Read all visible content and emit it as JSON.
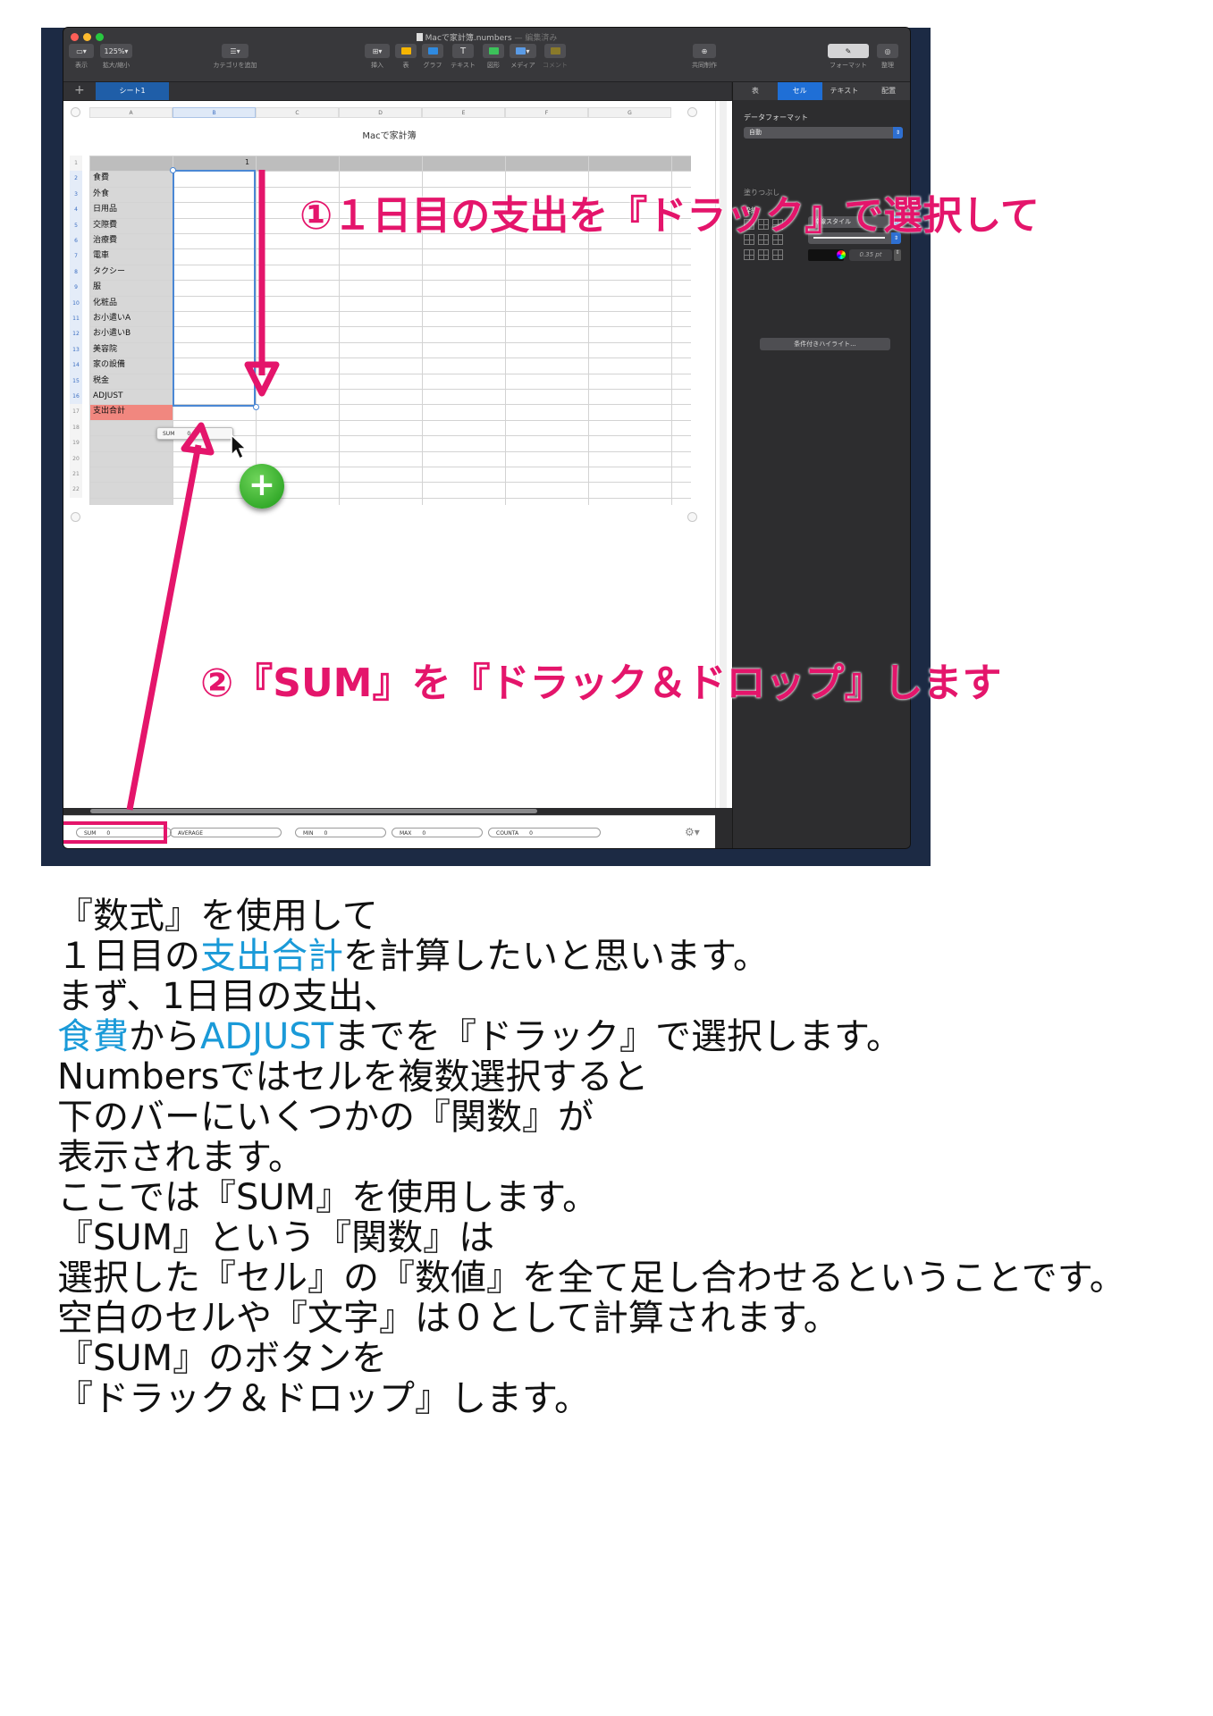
{
  "window": {
    "title": "Macで家計簿.numbers",
    "title_status": "— 編集済み"
  },
  "toolbar": {
    "view_label": "表示",
    "zoom_value": "125%",
    "zoom_label": "拡大/縮小",
    "category_label": "カテゴリを追加",
    "insert_label": "挿入",
    "table_label": "表",
    "chart_label": "グラフ",
    "text_label": "テキスト",
    "shape_label": "図形",
    "media_label": "メディア",
    "comment_label": "コメント",
    "collab_label": "共同制作",
    "format_label": "フォーマット",
    "organize_label": "整理"
  },
  "sheet_tab": "シート1",
  "spreadsheet": {
    "title": "Macで家計簿",
    "columns": [
      "A",
      "B",
      "C",
      "D",
      "E",
      "F",
      "G"
    ],
    "header_value": "1",
    "row_numbers": [
      "1",
      "2",
      "3",
      "4",
      "5",
      "6",
      "7",
      "8",
      "9",
      "10",
      "11",
      "12",
      "13",
      "14",
      "15",
      "16",
      "17",
      "18",
      "19",
      "20",
      "21",
      "22"
    ],
    "row_labels": [
      "食費",
      "外食",
      "日用品",
      "交際費",
      "治療費",
      "電車",
      "タクシー",
      "服",
      "化粧品",
      "お小遣いA",
      "お小遣いB",
      "美容院",
      "家の設備",
      "税金",
      "ADJUST",
      "支出合計"
    ],
    "sum_chip": {
      "label": "SUM",
      "value": "0"
    }
  },
  "formula_bar": [
    {
      "label": "SUM",
      "value": "0"
    },
    {
      "label": "AVERAGE",
      "value": ""
    },
    {
      "label": "MIN",
      "value": "0"
    },
    {
      "label": "MAX",
      "value": "0"
    },
    {
      "label": "COUNTA",
      "value": "0"
    }
  ],
  "inspector": {
    "tabs": [
      "表",
      "セル",
      "テキスト",
      "配置"
    ],
    "active_tab": "セル",
    "data_format_heading": "データフォーマット",
    "data_format_value": "自動",
    "fill_heading": "塗りつぶし",
    "border_heading": "枠線",
    "border_style_value": "枠線スタイル",
    "border_width": "0.35 pt",
    "conditional_button": "条件付きハイライト..."
  },
  "annotations": {
    "step1": "①１日目の支出を『ドラック』で選択して",
    "step2": "②『SUM』を『ドラック＆ドロップ』します",
    "color": "#e4156b"
  },
  "explanation": {
    "line1": "『数式』を使用して",
    "line2_pre": "１日目の",
    "line2_blue": "支出合計",
    "line2_post": "を計算したいと思います。",
    "line3": "まず、1日目の支出、",
    "line4_blue1": "食費",
    "line4_mid": "から",
    "line4_blue2": "ADJUST",
    "line4_post": "までを『ドラック』で選択します。",
    "line5": "Numbersではセルを複数選択すると",
    "line6": "下のバーにいくつかの『関数』が",
    "line7": "表示されます。",
    "line8": "ここでは『SUM』を使用します。",
    "line9": "『SUM』という『関数』は",
    "line10": "選択した『セル』の『数値』を全て足し合わせるということです。",
    "line11": "空白のセルや『文字』は０として計算されます。",
    "line12": "『SUM』のボタンを",
    "line13": "『ドラック＆ドロップ』します。",
    "highlight_color": "#1a9ad8"
  }
}
